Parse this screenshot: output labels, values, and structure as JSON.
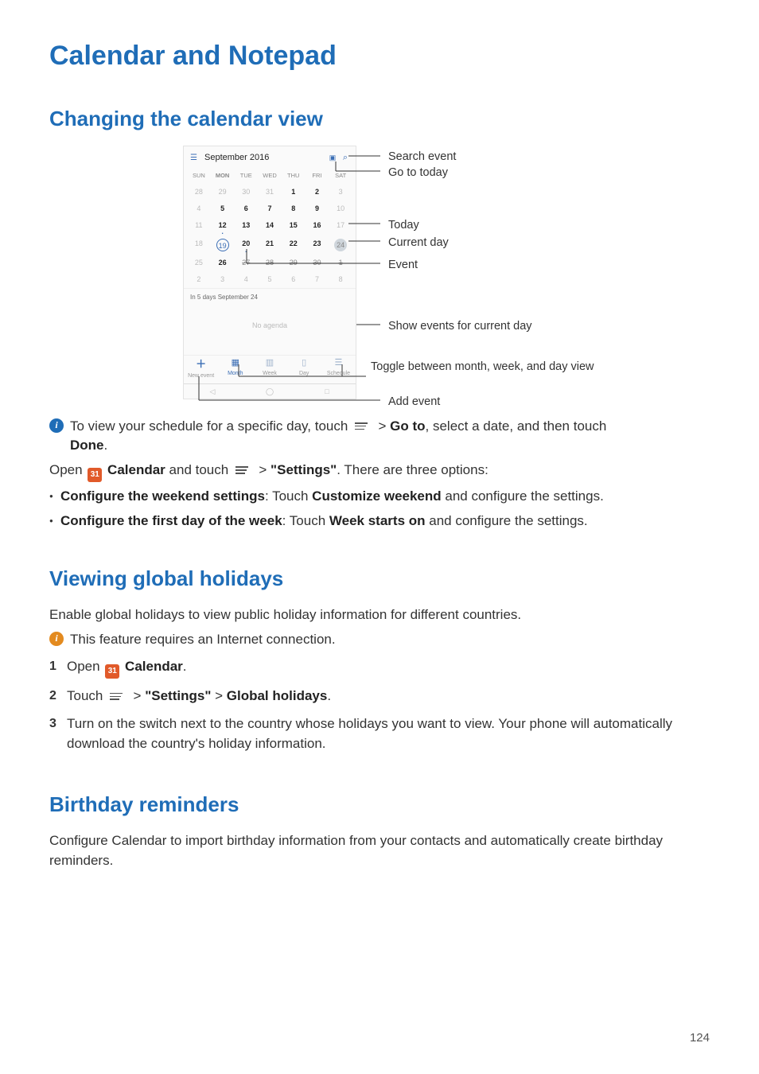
{
  "page": {
    "title": "Calendar and Notepad",
    "number": "124"
  },
  "section1": {
    "title": "Changing the calendar view",
    "phone": {
      "month_label": "September 2016",
      "dow": [
        "SUN",
        "MON",
        "TUE",
        "WED",
        "THU",
        "FRI",
        "SAT"
      ],
      "rows": [
        [
          {
            "v": "28",
            "c": "grey"
          },
          {
            "v": "29",
            "c": "grey"
          },
          {
            "v": "30",
            "c": "grey"
          },
          {
            "v": "31",
            "c": "grey"
          },
          {
            "v": "1",
            "c": "bold"
          },
          {
            "v": "2",
            "c": "bold"
          },
          {
            "v": "3",
            "c": "grey"
          }
        ],
        [
          {
            "v": "4",
            "c": "grey"
          },
          {
            "v": "5",
            "c": "bold"
          },
          {
            "v": "6",
            "c": "bold"
          },
          {
            "v": "7",
            "c": "bold"
          },
          {
            "v": "8",
            "c": "bold"
          },
          {
            "v": "9",
            "c": "bold"
          },
          {
            "v": "10",
            "c": "grey"
          }
        ],
        [
          {
            "v": "11",
            "c": "grey"
          },
          {
            "v": "12",
            "c": "bold event-dot"
          },
          {
            "v": "13",
            "c": "bold"
          },
          {
            "v": "14",
            "c": "bold"
          },
          {
            "v": "15",
            "c": "bold"
          },
          {
            "v": "16",
            "c": "bold"
          },
          {
            "v": "17",
            "c": "grey"
          }
        ],
        [
          {
            "v": "18",
            "c": "grey"
          },
          {
            "v": "19",
            "c": "bold",
            "circle": "today"
          },
          {
            "v": "20",
            "c": "bold event-dot"
          },
          {
            "v": "21",
            "c": "bold"
          },
          {
            "v": "22",
            "c": "bold"
          },
          {
            "v": "23",
            "c": "bold"
          },
          {
            "v": "24",
            "c": "grey",
            "circle": "cur"
          }
        ],
        [
          {
            "v": "25",
            "c": "grey"
          },
          {
            "v": "26",
            "c": "bold"
          },
          {
            "v": "27",
            "c": "strike"
          },
          {
            "v": "28",
            "c": "strike"
          },
          {
            "v": "29",
            "c": "strike"
          },
          {
            "v": "30",
            "c": "strike"
          },
          {
            "v": "1",
            "c": "strike grey"
          }
        ],
        [
          {
            "v": "2",
            "c": "grey"
          },
          {
            "v": "3",
            "c": "grey"
          },
          {
            "v": "4",
            "c": "grey"
          },
          {
            "v": "5",
            "c": "grey"
          },
          {
            "v": "6",
            "c": "grey"
          },
          {
            "v": "7",
            "c": "grey"
          },
          {
            "v": "8",
            "c": "grey"
          }
        ]
      ],
      "agenda_label": "In 5 days  September 24",
      "no_agenda": "No agenda",
      "tabs": [
        {
          "icon": "＋",
          "label": "New event",
          "cls": "add"
        },
        {
          "icon": "▦",
          "label": "Month",
          "cls": "active"
        },
        {
          "icon": "▥",
          "label": "Week",
          "cls": ""
        },
        {
          "icon": "▯",
          "label": "Day",
          "cls": ""
        },
        {
          "icon": "☰",
          "label": "Schedule",
          "cls": ""
        }
      ]
    },
    "callouts": {
      "search": "Search event",
      "goto": "Go to today",
      "today": "Today",
      "current": "Current day",
      "event": "Event",
      "show_events": "Show events for current day",
      "toggle": "Toggle between month, week, and day view",
      "add": "Add event"
    },
    "tip_line_a": "To view your schedule for a specific day, touch ",
    "tip_goto": "Go to",
    "tip_line_b": ", select a date, and then touch ",
    "tip_done": "Done",
    "open_line_a": "Open ",
    "open_cal_label": "Calendar",
    "open_line_b": " and touch ",
    "open_settings": "\"Settings\"",
    "open_line_c": ". There are three options:",
    "bullet1_a": "Configure the weekend settings",
    "bullet1_b": ": Touch ",
    "bullet1_c": "Customize weekend",
    "bullet1_d": " and configure the settings.",
    "bullet2_a": "Configure the first day of the week",
    "bullet2_b": ": Touch ",
    "bullet2_c": "Week starts on",
    "bullet2_d": " and configure the settings."
  },
  "section2": {
    "title": "Viewing global holidays",
    "intro": "Enable global holidays to view public holiday information for different countries.",
    "note": "This feature requires an Internet connection.",
    "step1_a": "Open ",
    "step1_b": "Calendar",
    "step1_c": ".",
    "step2_a": "Touch ",
    "step2_b": "\"Settings\"",
    "step2_c": "Global holidays",
    "step2_d": ".",
    "step3": "Turn on the switch next to the country whose holidays you want to view. Your phone will automatically download the country's holiday information."
  },
  "section3": {
    "title": "Birthday reminders",
    "intro": "Configure Calendar to import birthday information from your contacts and automatically create birthday reminders."
  },
  "icons": {
    "cal_num": "31"
  }
}
